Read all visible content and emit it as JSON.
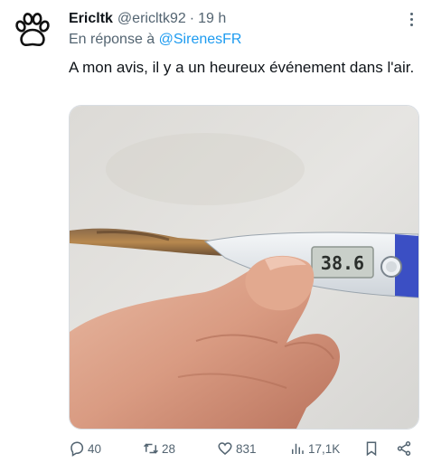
{
  "tweet": {
    "author_name": "Ericltk",
    "author_handle": "@ericltk92",
    "separator": "·",
    "time": "19 h",
    "reply_prefix": "En réponse à",
    "reply_mention": "@SirenesFR",
    "text": "A mon avis, il y a un heureux événement dans l'air.",
    "image": {
      "thermometer_display": "38.6"
    }
  },
  "actions": {
    "replies": "40",
    "retweets": "28",
    "likes": "831",
    "views": "17,1K"
  },
  "icons": {
    "avatar": "paw-print-icon",
    "more": "more-options-icon",
    "reply": "reply-icon",
    "retweet": "retweet-icon",
    "like": "heart-icon",
    "views": "views-chart-icon",
    "bookmark": "bookmark-icon",
    "share": "share-icon"
  },
  "colors": {
    "text": "#0f1419",
    "secondary": "#536471",
    "link": "#1d9bf0",
    "background": "#ffffff"
  }
}
